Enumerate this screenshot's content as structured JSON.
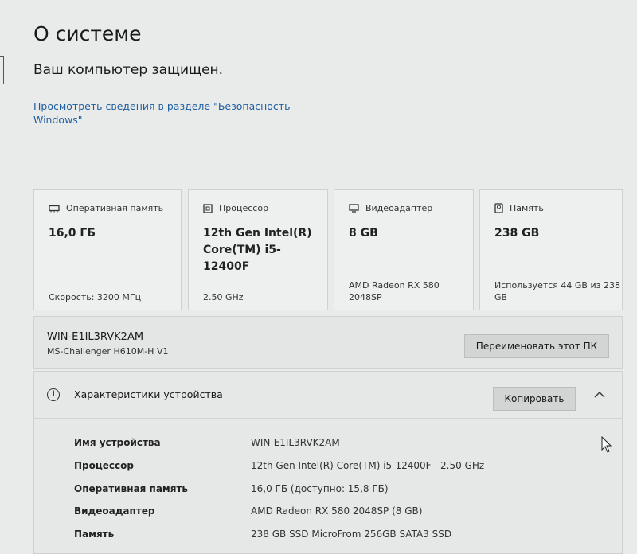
{
  "page": {
    "title": "О системе",
    "protection_status": "Ваш компьютер защищен.",
    "security_link": "Просмотреть сведения в разделе \"Безопасность Windows\""
  },
  "cards": [
    {
      "icon": "memory-icon",
      "label": "Оперативная память",
      "value": "16,0 ГБ",
      "detail": "Скорость: 3200 МГц"
    },
    {
      "icon": "processor-icon",
      "label": "Процессор",
      "value": "12th Gen Intel(R) Core(TM) i5-12400F",
      "detail": "2.50 GHz"
    },
    {
      "icon": "display-adapter-icon",
      "label": "Видеоадаптер",
      "value": "8 GB",
      "detail": "AMD Radeon RX 580 2048SP"
    },
    {
      "icon": "storage-icon",
      "label": "Память",
      "value": "238 GB",
      "detail": "Используется 44 GB из 238 GB"
    }
  ],
  "device": {
    "name": "WIN-E1IL3RVK2AM",
    "model": "MS-Challenger H610M-H V1",
    "rename_label": "Переименовать этот ПК"
  },
  "specs": {
    "title": "Характеристики устройства",
    "copy_label": "Копировать",
    "rows": [
      {
        "key": "Имя устройства",
        "value": "WIN-E1IL3RVK2AM"
      },
      {
        "key": "Процессор",
        "value": "12th Gen Intel(R) Core(TM) i5-12400F   2.50 GHz"
      },
      {
        "key": "Оперативная память",
        "value": "16,0 ГБ (доступно: 15,8 ГБ)"
      },
      {
        "key": "Видеоадаптер",
        "value": "AMD Radeon RX 580 2048SP (8 GB)"
      },
      {
        "key": "Память",
        "value": "238 GB SSD MicroFrom 256GB SATA3 SSD"
      }
    ]
  },
  "colors": {
    "link": "#1f5fa0",
    "background": "#e9eaea"
  }
}
